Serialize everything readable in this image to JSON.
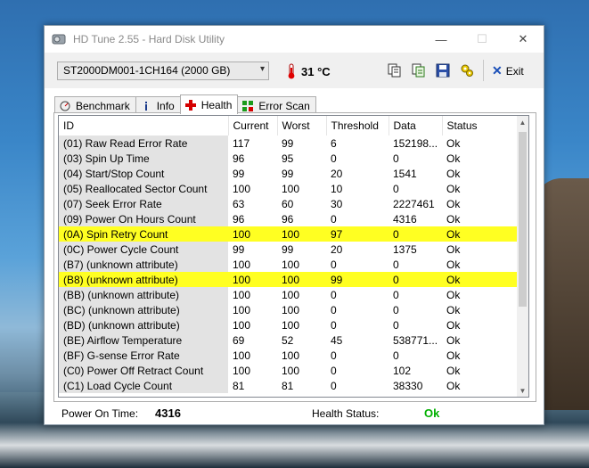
{
  "window": {
    "title": "HD Tune 2.55 - Hard Disk Utility",
    "minimize": "—",
    "maximize": "☐",
    "close": "✕"
  },
  "toolbar": {
    "drive": "ST2000DM001-1CH164 (2000 GB)",
    "temperature": "31 °C",
    "exit_label": "Exit",
    "icons": [
      "copy-icon",
      "copy-info-icon",
      "save-icon",
      "options-icon"
    ]
  },
  "tabs": [
    {
      "label": "Benchmark",
      "icon": "benchmark-icon"
    },
    {
      "label": "Info",
      "icon": "info-icon"
    },
    {
      "label": "Health",
      "icon": "health-icon",
      "active": true
    },
    {
      "label": "Error Scan",
      "icon": "error-scan-icon"
    }
  ],
  "table": {
    "columns": [
      "ID",
      "Current",
      "Worst",
      "Threshold",
      "Data",
      "Status"
    ],
    "rows": [
      {
        "id": "(01) Raw Read Error Rate",
        "current": "117",
        "worst": "99",
        "threshold": "6",
        "data": "152198...",
        "status": "Ok",
        "highlight": false
      },
      {
        "id": "(03) Spin Up Time",
        "current": "96",
        "worst": "95",
        "threshold": "0",
        "data": "0",
        "status": "Ok",
        "highlight": false
      },
      {
        "id": "(04) Start/Stop Count",
        "current": "99",
        "worst": "99",
        "threshold": "20",
        "data": "1541",
        "status": "Ok",
        "highlight": false
      },
      {
        "id": "(05) Reallocated Sector Count",
        "current": "100",
        "worst": "100",
        "threshold": "10",
        "data": "0",
        "status": "Ok",
        "highlight": false
      },
      {
        "id": "(07) Seek Error Rate",
        "current": "63",
        "worst": "60",
        "threshold": "30",
        "data": "2227461",
        "status": "Ok",
        "highlight": false
      },
      {
        "id": "(09) Power On Hours Count",
        "current": "96",
        "worst": "96",
        "threshold": "0",
        "data": "4316",
        "status": "Ok",
        "highlight": false
      },
      {
        "id": "(0A) Spin Retry Count",
        "current": "100",
        "worst": "100",
        "threshold": "97",
        "data": "0",
        "status": "Ok",
        "highlight": true
      },
      {
        "id": "(0C) Power Cycle Count",
        "current": "99",
        "worst": "99",
        "threshold": "20",
        "data": "1375",
        "status": "Ok",
        "highlight": false
      },
      {
        "id": "(B7) (unknown attribute)",
        "current": "100",
        "worst": "100",
        "threshold": "0",
        "data": "0",
        "status": "Ok",
        "highlight": false
      },
      {
        "id": "(B8) (unknown attribute)",
        "current": "100",
        "worst": "100",
        "threshold": "99",
        "data": "0",
        "status": "Ok",
        "highlight": true
      },
      {
        "id": "(BB) (unknown attribute)",
        "current": "100",
        "worst": "100",
        "threshold": "0",
        "data": "0",
        "status": "Ok",
        "highlight": false
      },
      {
        "id": "(BC) (unknown attribute)",
        "current": "100",
        "worst": "100",
        "threshold": "0",
        "data": "0",
        "status": "Ok",
        "highlight": false
      },
      {
        "id": "(BD) (unknown attribute)",
        "current": "100",
        "worst": "100",
        "threshold": "0",
        "data": "0",
        "status": "Ok",
        "highlight": false
      },
      {
        "id": "(BE) Airflow Temperature",
        "current": "69",
        "worst": "52",
        "threshold": "45",
        "data": "538771...",
        "status": "Ok",
        "highlight": false
      },
      {
        "id": "(BF) G-sense Error Rate",
        "current": "100",
        "worst": "100",
        "threshold": "0",
        "data": "0",
        "status": "Ok",
        "highlight": false
      },
      {
        "id": "(C0) Power Off Retract Count",
        "current": "100",
        "worst": "100",
        "threshold": "0",
        "data": "102",
        "status": "Ok",
        "highlight": false
      },
      {
        "id": "(C1) Load Cycle Count",
        "current": "81",
        "worst": "81",
        "threshold": "0",
        "data": "38330",
        "status": "Ok",
        "highlight": false
      }
    ]
  },
  "status": {
    "power_on_label": "Power On Time:",
    "power_on_value": "4316",
    "health_label": "Health Status:",
    "health_value": "Ok",
    "health_color": "#00b000"
  },
  "colors": {
    "highlight": "#ffff22",
    "id_column_bg": "#e3e3e3"
  }
}
